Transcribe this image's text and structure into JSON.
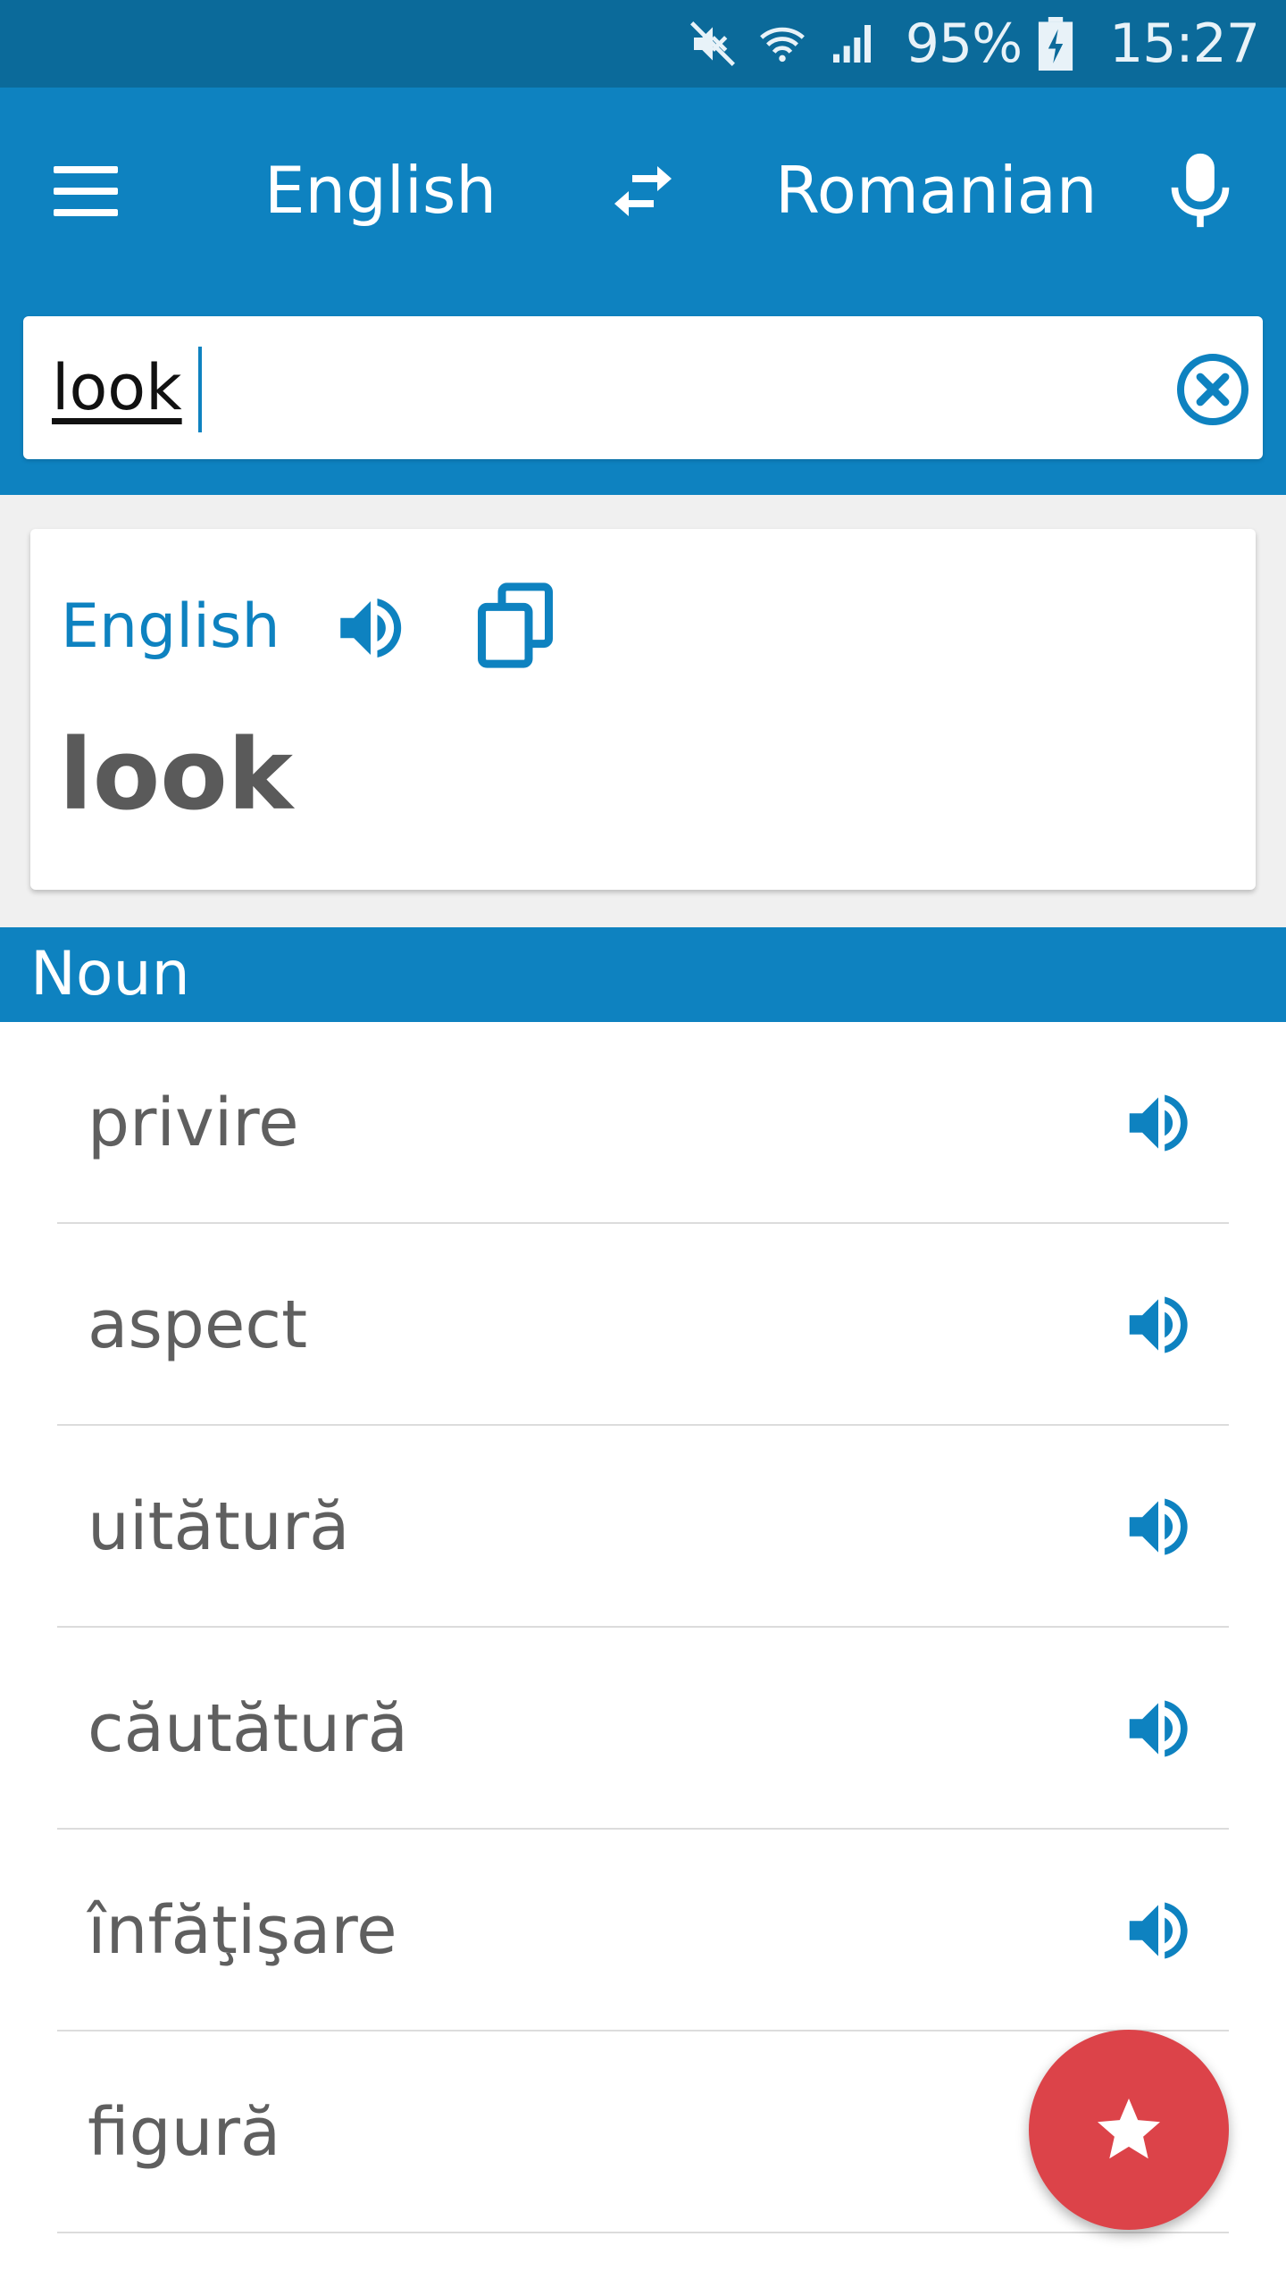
{
  "status_bar": {
    "battery_percent": "95%",
    "time": "15:27",
    "icons": [
      "mute-icon",
      "wifi-icon",
      "signal-icon",
      "battery-charging-icon"
    ]
  },
  "toolbar": {
    "source_language": "English",
    "target_language": "Romanian",
    "icons": [
      "menu-icon",
      "swap-icon",
      "microphone-icon"
    ]
  },
  "search": {
    "value": "look",
    "clear_icon": "clear-icon"
  },
  "result_card": {
    "language": "English",
    "word": "look",
    "icons": [
      "speaker-icon",
      "copy-icon"
    ]
  },
  "section": {
    "title": "Noun"
  },
  "translations": [
    {
      "text": "privire",
      "has_audio": true
    },
    {
      "text": "aspect",
      "has_audio": true
    },
    {
      "text": "uitătură",
      "has_audio": true
    },
    {
      "text": "căutătură",
      "has_audio": true
    },
    {
      "text": "înfăţişare",
      "has_audio": true
    },
    {
      "text": "figură",
      "has_audio": false
    }
  ],
  "fab": {
    "icon": "star-icon"
  },
  "colors": {
    "status_bar": "#0b6a9a",
    "primary": "#0e82c0",
    "fab": "#dc4349",
    "text_gray": "#5f5f5f"
  }
}
